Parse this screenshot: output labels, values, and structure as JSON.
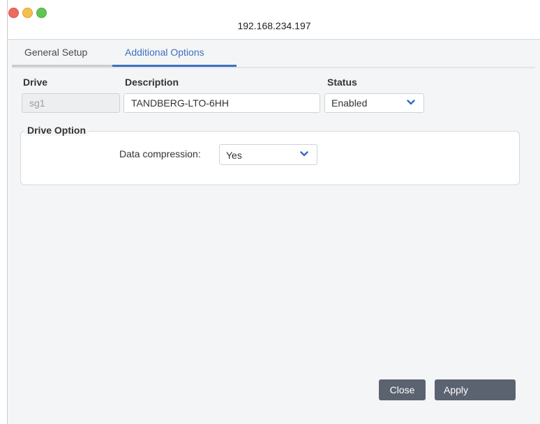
{
  "window": {
    "title": "192.168.234.197"
  },
  "tabs": [
    {
      "label": "General Setup",
      "active": false
    },
    {
      "label": "Additional Options",
      "active": true
    }
  ],
  "drive_table": {
    "drive_label": "Drive",
    "description_label": "Description",
    "status_label": "Status",
    "drive_placeholder": "sg1",
    "description_value": "TANDBERG-LTO-6HH",
    "status_value": "Enabled"
  },
  "drive_option": {
    "legend": "Drive Option",
    "compression_label": "Data compression:",
    "compression_value": "Yes"
  },
  "buttons": {
    "close": "Close",
    "apply": "Apply"
  },
  "colors": {
    "accent": "#3d6fc2",
    "button": "#5b6270",
    "close_dot": "#ed6a5e",
    "minimize_dot": "#f5bf4f",
    "zoom_dot": "#61c554"
  },
  "icons": {
    "select_arrow": "chevron-down-icon"
  }
}
